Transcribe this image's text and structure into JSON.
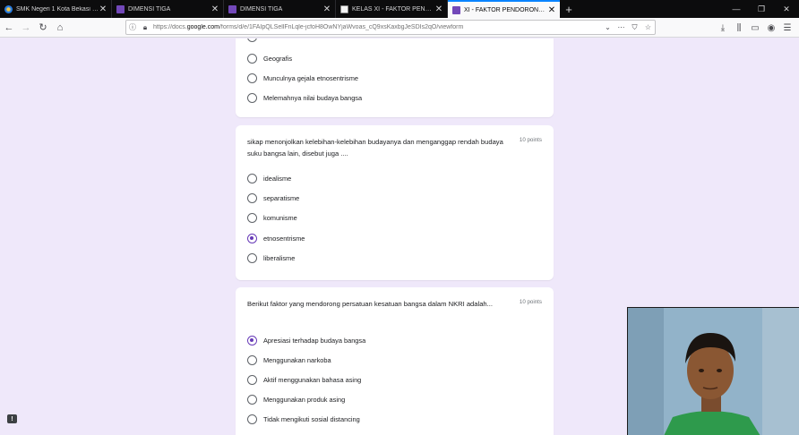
{
  "tabs": [
    {
      "title": "SMK Negeri 1 Kota Bekasi - PO",
      "icon": "school-logo-icon",
      "active": false
    },
    {
      "title": "DIMENSI TIGA",
      "icon": "forms-icon",
      "active": false
    },
    {
      "title": "DIMENSI TIGA",
      "icon": "forms-icon",
      "active": false
    },
    {
      "title": "KELAS XI - FAKTOR PENDORONG",
      "icon": "classroom-icon",
      "active": false
    },
    {
      "title": "XI - FAKTOR PENDORONG DAN",
      "icon": "forms-icon",
      "active": true
    }
  ],
  "toolbar": {
    "back": "←",
    "forward": "→",
    "reload": "↻",
    "home": "⌂",
    "new_tab": "+",
    "close_tab": "✕",
    "minimize": "—",
    "restore": "❐",
    "close": "✕"
  },
  "urlbar": {
    "prefix": "https://docs.",
    "domain": "google.com",
    "path": "/forms/d/e/1FAIpQLSellFnLqle-jcfoH8OwNYjaWvoas_cQ9xsKaxbgJeSDIs2qO/viewform",
    "dropdown": "⌄",
    "more": "⋯",
    "pocket": "⛉",
    "bookmark": "☆"
  },
  "right_buttons": {
    "downloads": "⤓",
    "library": "⫼",
    "sidebar": "▭",
    "account": "◉",
    "menu": "☰"
  },
  "questions": [
    {
      "text": "",
      "points": "",
      "options": [
        {
          "label": "Geografis",
          "selected": false
        },
        {
          "label": "Munculnya gejala etnosentrisme",
          "selected": false
        },
        {
          "label": "Melemahnya nilai budaya bangsa",
          "selected": false
        }
      ]
    },
    {
      "text": "sikap menonjolkan kelebihan-kelebihan budayanya dan menganggap rendah budaya suku bangsa lain, disebut juga ....",
      "points": "10 points",
      "options": [
        {
          "label": "idealisme",
          "selected": false
        },
        {
          "label": "separatisme",
          "selected": false
        },
        {
          "label": "komunisme",
          "selected": false
        },
        {
          "label": "etnosentrisme",
          "selected": true
        },
        {
          "label": "liberalisme",
          "selected": false
        }
      ]
    },
    {
      "text": "Berikut faktor yang mendorong persatuan kesatuan bangsa dalam NKRI adalah...",
      "points": "10 points",
      "options": [
        {
          "label": "Apresiasi terhadap budaya bangsa",
          "selected": true
        },
        {
          "label": "Menggunakan narkoba",
          "selected": false
        },
        {
          "label": "Aktif menggunakan bahasa asing",
          "selected": false
        },
        {
          "label": "Menggunakan produk asing",
          "selected": false
        },
        {
          "label": "Tidak mengikuti sosial distancing",
          "selected": false
        }
      ]
    }
  ],
  "feedback_icon": "!",
  "colors": {
    "accent": "#673ab7",
    "background": "#efe8fa",
    "tab_active_indicator": "#0a84ff"
  }
}
